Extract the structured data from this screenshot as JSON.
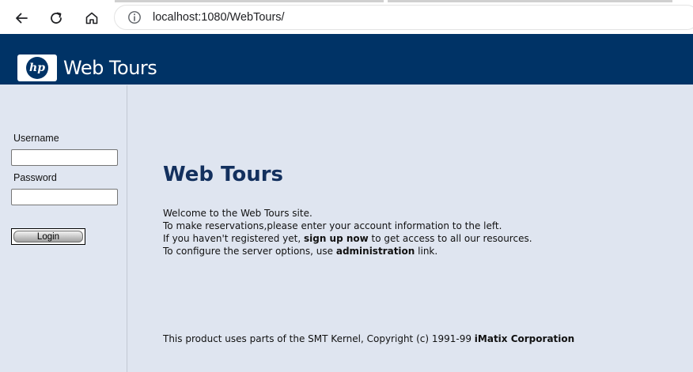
{
  "browser": {
    "url": "localhost:1080/WebTours/"
  },
  "banner": {
    "logo_text": "hp",
    "site_title": "Web Tours"
  },
  "login": {
    "username_label": "Username",
    "password_label": "Password",
    "username_value": "",
    "password_value": "",
    "login_button": "Login"
  },
  "main": {
    "heading": "Web Tours",
    "line1": "Welcome to the Web Tours site.",
    "line2": "To make reservations,please enter your account information to the left.",
    "line3_pre": "If you haven't registered yet, ",
    "line3_link": "sign up now",
    "line3_post": " to get access to all our resources.",
    "line4_pre": "To configure the server options, use ",
    "line4_link": "administration",
    "line4_post": " link."
  },
  "footer": {
    "text_pre": "This product uses parts of the SMT Kernel, Copyright (c) 1991-99 ",
    "company": "iMatix Corporation"
  },
  "colors": {
    "banner": "#003366",
    "page_background": "#dfe5f0",
    "heading": "#13305e"
  },
  "icons": [
    "back-arrow-icon",
    "reload-icon",
    "home-icon",
    "info-icon",
    "hp-logo-icon"
  ]
}
